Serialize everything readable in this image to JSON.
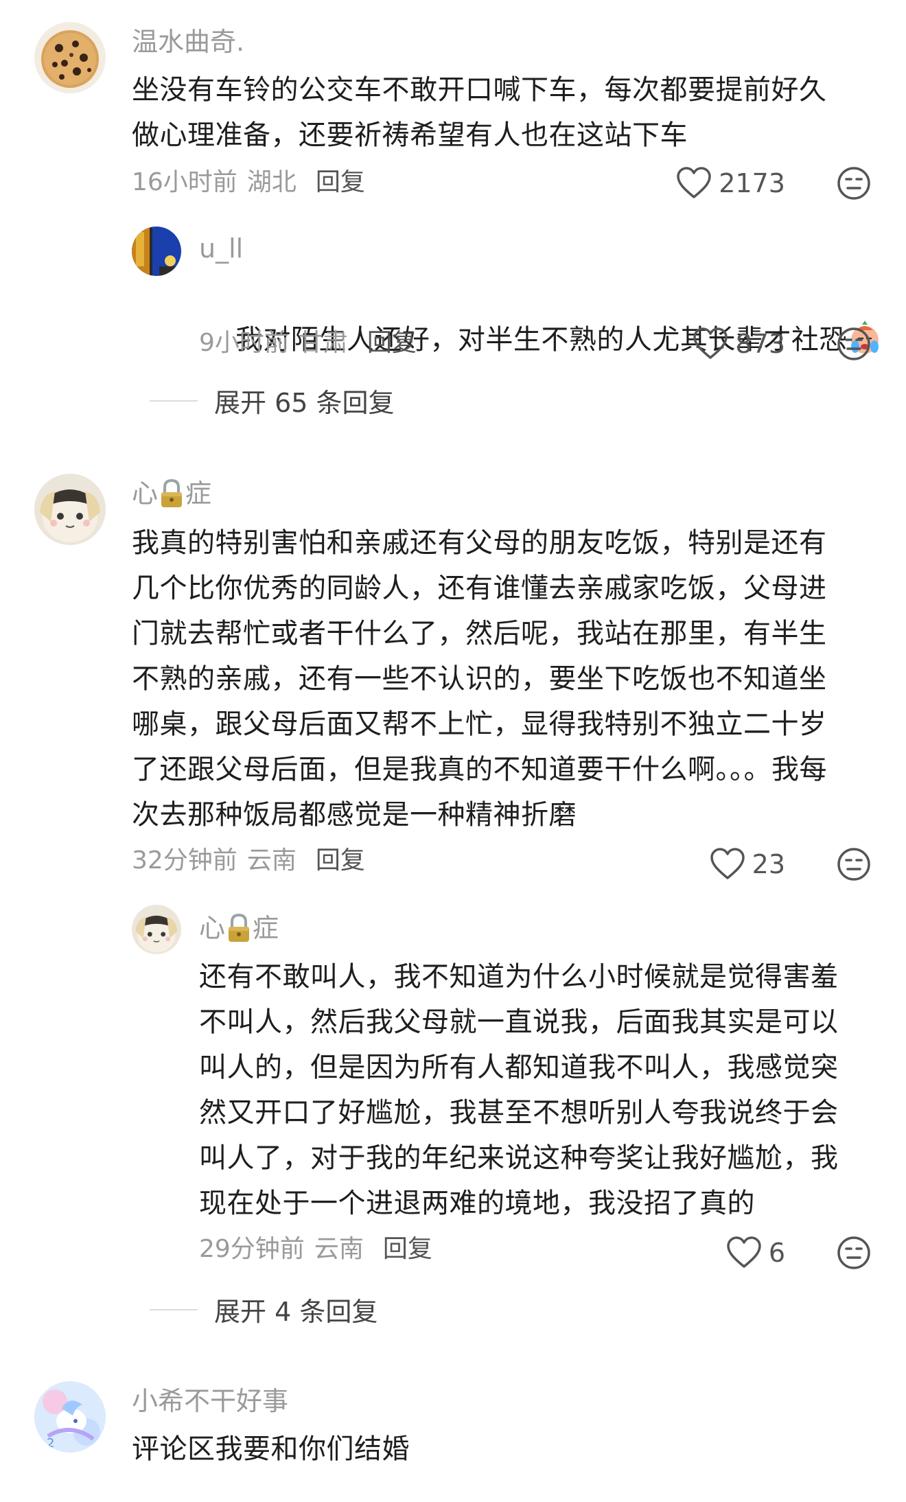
{
  "comments": [
    {
      "username": "温水曲奇.",
      "avatar_icon": "cookie-avatar",
      "content": "坐没有车铃的公交车不敢开口喊下车，每次都要提前好久\n做心理准备，还要祈祷希望有人也在这站下车",
      "time": "16小时前",
      "region": "湖北",
      "reply_label": "回复",
      "likes": "2173",
      "replies": [
        {
          "username": "u_ll",
          "avatar_icon": "window-night-avatar",
          "content": "我对陌生人还好，对半生不熟的人尤其长辈才社恐",
          "trailing_emoji": "crying-emoji",
          "time": "9小时前",
          "region": "甘肃",
          "reply_label": "回复",
          "likes": "873"
        }
      ],
      "expand_label": "展开 65 条回复"
    },
    {
      "username_prefix": "心",
      "username_icon": "lock-icon",
      "username_suffix": "症",
      "avatar_icon": "anime-doll-avatar",
      "content": "我真的特别害怕和亲戚还有父母的朋友吃饭，特别是还有\n几个比你优秀的同龄人，还有谁懂去亲戚家吃饭，父母进\n门就去帮忙或者干什么了，然后呢，我站在那里，有半生\n不熟的亲戚，还有一些不认识的，要坐下吃饭也不知道坐\n哪桌，跟父母后面又帮不上忙，显得我特别不独立二十岁\n了还跟父母后面，但是我真的不知道要干什么啊。。。我每\n次去那种饭局都感觉是一种精神折磨",
      "time": "32分钟前",
      "region": "云南",
      "reply_label": "回复",
      "likes": "23",
      "replies": [
        {
          "username_prefix": "心",
          "username_icon": "lock-icon",
          "username_suffix": "症",
          "avatar_icon": "anime-doll-avatar",
          "content": "还有不敢叫人，我不知道为什么小时候就是觉得害羞\n不叫人，然后我父母就一直说我，后面我其实是可以\n叫人的，但是因为所有人都知道我不叫人，我感觉突\n然又开口了好尴尬，我甚至不想听别人夸我说终于会\n叫人了，对于我的年纪来说这种夸奖让我好尴尬，我\n现在处于一个进退两难的境地，我没招了真的",
          "time": "29分钟前",
          "region": "云南",
          "reply_label": "回复",
          "likes": "6"
        }
      ],
      "expand_label": "展开 4 条回复"
    },
    {
      "username": "小希不干好事",
      "avatar_icon": "pastel-pony-avatar",
      "content": "评论区我要和你们结婚"
    }
  ],
  "icons": {
    "like": "heart-outline-icon",
    "dislike": "neutral-face-icon"
  },
  "colors": {
    "text": "#1e1e1e",
    "muted": "#9a9a9a",
    "reply": "#555555"
  }
}
